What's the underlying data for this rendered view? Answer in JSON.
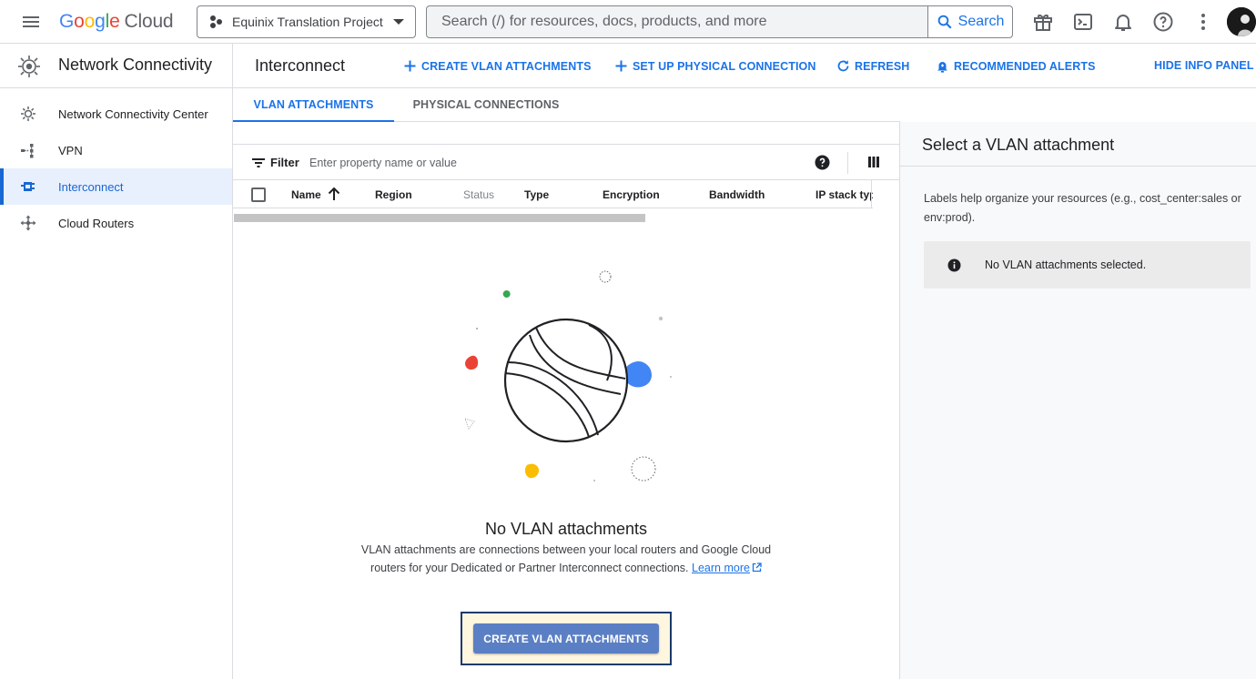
{
  "topbar": {
    "logo_letters": [
      "G",
      "o",
      "o",
      "g",
      "l",
      "e"
    ],
    "logo_cloud": "Cloud",
    "project_name": "Equinix Translation Project",
    "search_placeholder": "Search (/) for resources, docs, products, and more",
    "search_button": "Search"
  },
  "leftnav": {
    "title": "Network Connectivity",
    "items": [
      {
        "label": "Network Connectivity Center",
        "icon": "hub-icon"
      },
      {
        "label": "VPN",
        "icon": "vpn-icon"
      },
      {
        "label": "Interconnect",
        "icon": "interconnect-icon",
        "active": true
      },
      {
        "label": "Cloud Routers",
        "icon": "router-icon"
      }
    ]
  },
  "header": {
    "title": "Interconnect",
    "actions": {
      "create_vlan": "CREATE VLAN ATTACHMENTS",
      "setup_physical": "SET UP PHYSICAL CONNECTION",
      "refresh": "REFRESH",
      "alerts": "RECOMMENDED ALERTS",
      "hide_panel": "HIDE INFO PANEL"
    }
  },
  "tabs": [
    {
      "label": "VLAN ATTACHMENTS",
      "active": true
    },
    {
      "label": "PHYSICAL CONNECTIONS",
      "active": false
    }
  ],
  "table": {
    "filter_label": "Filter",
    "filter_placeholder": "Enter property name or value",
    "columns": [
      "Name",
      "Region",
      "Status",
      "Type",
      "Encryption",
      "Bandwidth",
      "IP stack typ"
    ]
  },
  "empty_state": {
    "title": "No VLAN attachments",
    "desc_main": "VLAN attachments are connections between your local routers and Google Cloud routers for your Dedicated or Partner Interconnect connections.",
    "link_word1": "Learn",
    "link_word2": "more",
    "cta": "CREATE VLAN ATTACHMENTS"
  },
  "info_panel": {
    "title": "Select a VLAN attachment",
    "description": "Labels help organize your resources (e.g., cost_center:sales or env:prod).",
    "notice": "No VLAN attachments selected."
  },
  "colors": {
    "accent": "#1a73e8",
    "cta_bg": "#5b7fc4",
    "highlight_frame": "#1b3a6b",
    "highlight_fill": "#fff6e0"
  }
}
